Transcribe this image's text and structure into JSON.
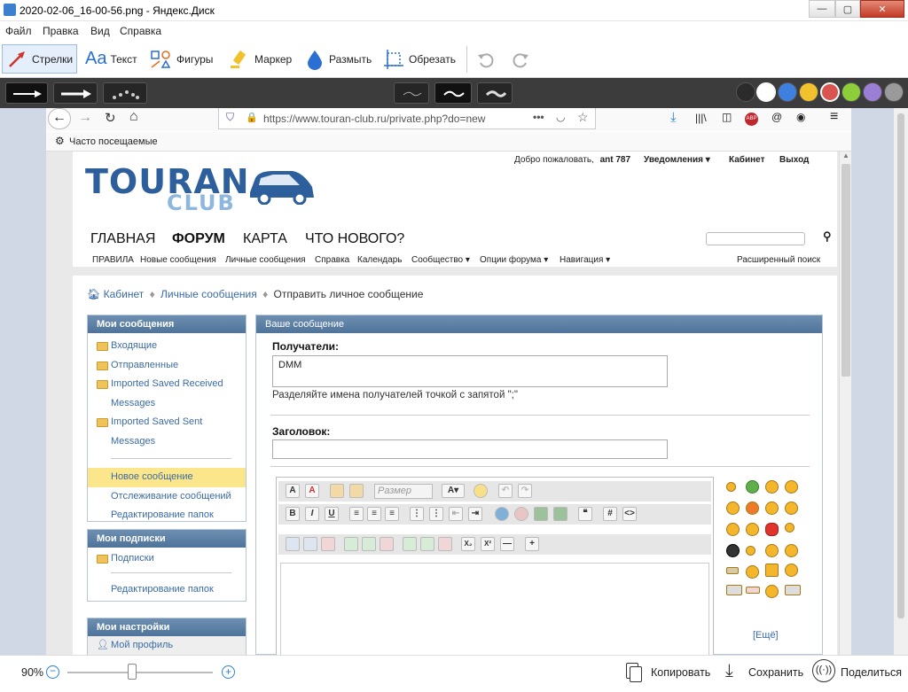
{
  "window": {
    "title": "2020-02-06_16-00-56.png - Яндекс.Диск",
    "minimize": "—",
    "maximize": "▢",
    "close": "✕"
  },
  "menu": [
    "Файл",
    "Правка",
    "Вид",
    "Справка"
  ],
  "tools": [
    {
      "label": "Стрелки",
      "icon": "arrow-icon"
    },
    {
      "label": "Текст",
      "icon": "text-icon"
    },
    {
      "label": "Фигуры",
      "icon": "shapes-icon"
    },
    {
      "label": "Маркер",
      "icon": "marker-icon"
    },
    {
      "label": "Размыть",
      "icon": "blur-drop-icon"
    },
    {
      "label": "Обрезать",
      "icon": "crop-icon"
    }
  ],
  "palette": [
    "#2b2b2b",
    "#ffffff",
    "#3f7fe0",
    "#f2c12e",
    "#d9534f",
    "#8ccf3a",
    "#9b7fd6",
    "#9a9a9a"
  ],
  "browser": {
    "url": "https://www.touran-club.ru/private.php?do=new",
    "bookmark": "Часто посещаемые"
  },
  "site": {
    "welcome": "Добро пожаловать,",
    "user": "ant 787",
    "notifications": "Уведомления ▾",
    "cabinet": "Кабинет",
    "logout": "Выход",
    "logo_main": "TOURAN",
    "logo_sub": "CLUB",
    "nav": [
      "ГЛАВНАЯ",
      "ФОРУМ",
      "КАРТА",
      "ЧТО НОВОГО?"
    ],
    "subnav": [
      "ПРАВИЛА",
      "Новые сообщения",
      "Личные сообщения",
      "Справка",
      "Календарь",
      "Сообщество ▾",
      "Опции форума ▾",
      "Навигация ▾"
    ],
    "adv_search": "Расширенный поиск"
  },
  "breadcrumb": {
    "home": "Кабинет",
    "mid": "Личные сообщения",
    "current": "Отправить личное сообщение"
  },
  "sidebar": {
    "messages_title": "Мои сообщения",
    "folders": [
      "Входящие",
      "Отправленные",
      "Imported Saved Received",
      "Messages",
      "Imported Saved Sent",
      "Messages"
    ],
    "new_msg": "Новое сообщение",
    "tracking": "Отслеживание сообщений",
    "edit_folders": "Редактирование папок",
    "subs_title": "Мои подписки",
    "subs": "Подписки",
    "subs_edit": "Редактирование папок",
    "settings_title": "Мои настройки",
    "profile": "Мой профиль"
  },
  "compose": {
    "panel_title": "Ваше сообщение",
    "recipients_label": "Получатели:",
    "recipients_value": "DMM",
    "recipients_hint": "Разделяйте имена получателей точкой с запятой \";\"",
    "subject_label": "Заголовок:",
    "subject_value": "",
    "size_placeholder": "Размер",
    "more_smilies": "[Ещё]"
  },
  "footer": {
    "zoom": "90%",
    "copy": "Копировать",
    "save": "Сохранить",
    "share": "Поделиться"
  }
}
